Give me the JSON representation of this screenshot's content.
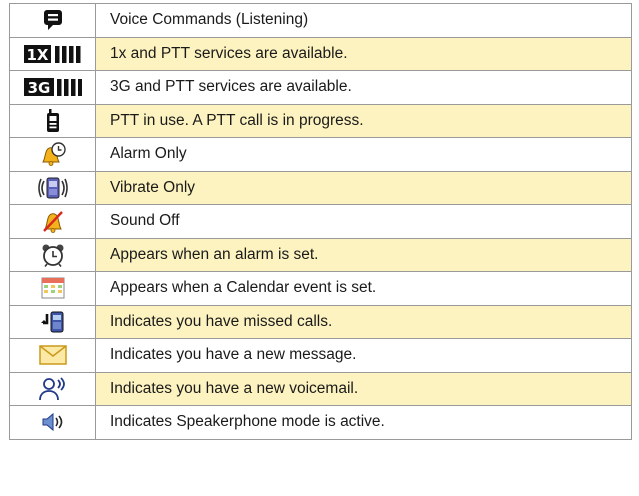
{
  "colors": {
    "row_highlight": "#fdf3c0",
    "border": "#9a9a9a",
    "text": "#1a1a1a"
  },
  "rows": [
    {
      "icon": "voice-commands-icon",
      "text": "Voice Commands (Listening)",
      "shaded": false
    },
    {
      "icon": "1x-signal-icon",
      "text": "1x and PTT services are available.",
      "shaded": true
    },
    {
      "icon": "3g-signal-icon",
      "text": "3G and PTT services are available.",
      "shaded": false
    },
    {
      "icon": "ptt-phone-icon",
      "text": "PTT in use. A PTT call is in progress.",
      "shaded": true
    },
    {
      "icon": "alarm-only-icon",
      "text": "Alarm Only",
      "shaded": false
    },
    {
      "icon": "vibrate-only-icon",
      "text": "Vibrate Only",
      "shaded": true
    },
    {
      "icon": "sound-off-icon",
      "text": "Sound Off",
      "shaded": false
    },
    {
      "icon": "alarm-clock-icon",
      "text": "Appears when an alarm is set.",
      "shaded": true
    },
    {
      "icon": "calendar-icon",
      "text": "Appears when a Calendar event is set.",
      "shaded": false
    },
    {
      "icon": "missed-call-icon",
      "text": "Indicates you have missed calls.",
      "shaded": true
    },
    {
      "icon": "envelope-icon",
      "text": "Indicates you have a new message.",
      "shaded": false
    },
    {
      "icon": "voicemail-icon",
      "text": "Indicates you have a new voicemail.",
      "shaded": true
    },
    {
      "icon": "speakerphone-icon",
      "text": "Indicates Speakerphone mode is active.",
      "shaded": false
    }
  ]
}
